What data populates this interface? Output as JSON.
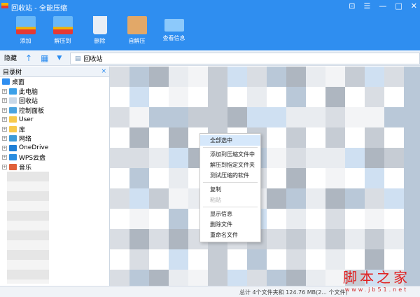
{
  "window": {
    "title": "回收站 - 全能压缩",
    "controls": [
      "inbox-icon",
      "menu-icon",
      "minimize-icon",
      "maximize-icon",
      "close-icon"
    ]
  },
  "toolbar": [
    {
      "label": "添加",
      "icon": "add-archive-icon"
    },
    {
      "label": "解压到",
      "icon": "extract-icon"
    },
    {
      "label": "删除",
      "icon": "trash-icon"
    },
    {
      "label": "自解压",
      "icon": "self-extract-box-icon"
    },
    {
      "label": "查看信息",
      "icon": "envelope-icon"
    }
  ],
  "navbar": {
    "hide_label": "隐藏",
    "path": "回收站"
  },
  "tree": {
    "title": "目录树",
    "close": "×",
    "items": [
      {
        "label": "桌面",
        "color": "#2f8ef0"
      },
      {
        "label": "此电脑",
        "color": "#3ba0e8"
      },
      {
        "label": "回收站",
        "color": "#c8d8e8"
      },
      {
        "label": "控制面板",
        "color": "#4aa3df"
      },
      {
        "label": "User",
        "color": "#f7c94b"
      },
      {
        "label": "库",
        "color": "#f7c94b"
      },
      {
        "label": "网络",
        "color": "#3c9ad8"
      },
      {
        "label": "OneDrive",
        "color": "#1f7fd6"
      },
      {
        "label": "WPS云盘",
        "color": "#2a8de0"
      },
      {
        "label": "音乐",
        "color": "#e0603a"
      }
    ]
  },
  "context_menu": {
    "items": [
      {
        "label": "全部选中",
        "state": "highlighted"
      },
      {
        "sep": true
      },
      {
        "label": "添加到压缩文件中"
      },
      {
        "label": "解压到指定文件夹"
      },
      {
        "label": "测试压缩的软件"
      },
      {
        "sep": true
      },
      {
        "label": "复制"
      },
      {
        "label": "粘贴",
        "state": "disabled"
      },
      {
        "sep": true
      },
      {
        "label": "显示信息"
      },
      {
        "label": "删除文件"
      },
      {
        "label": "重命名文件"
      }
    ]
  },
  "status": {
    "text": "总计 4个文件夹和 124.76 MB(2... 个文件)"
  },
  "watermark": {
    "title": "脚本之家",
    "url": "www.jb51.net"
  }
}
